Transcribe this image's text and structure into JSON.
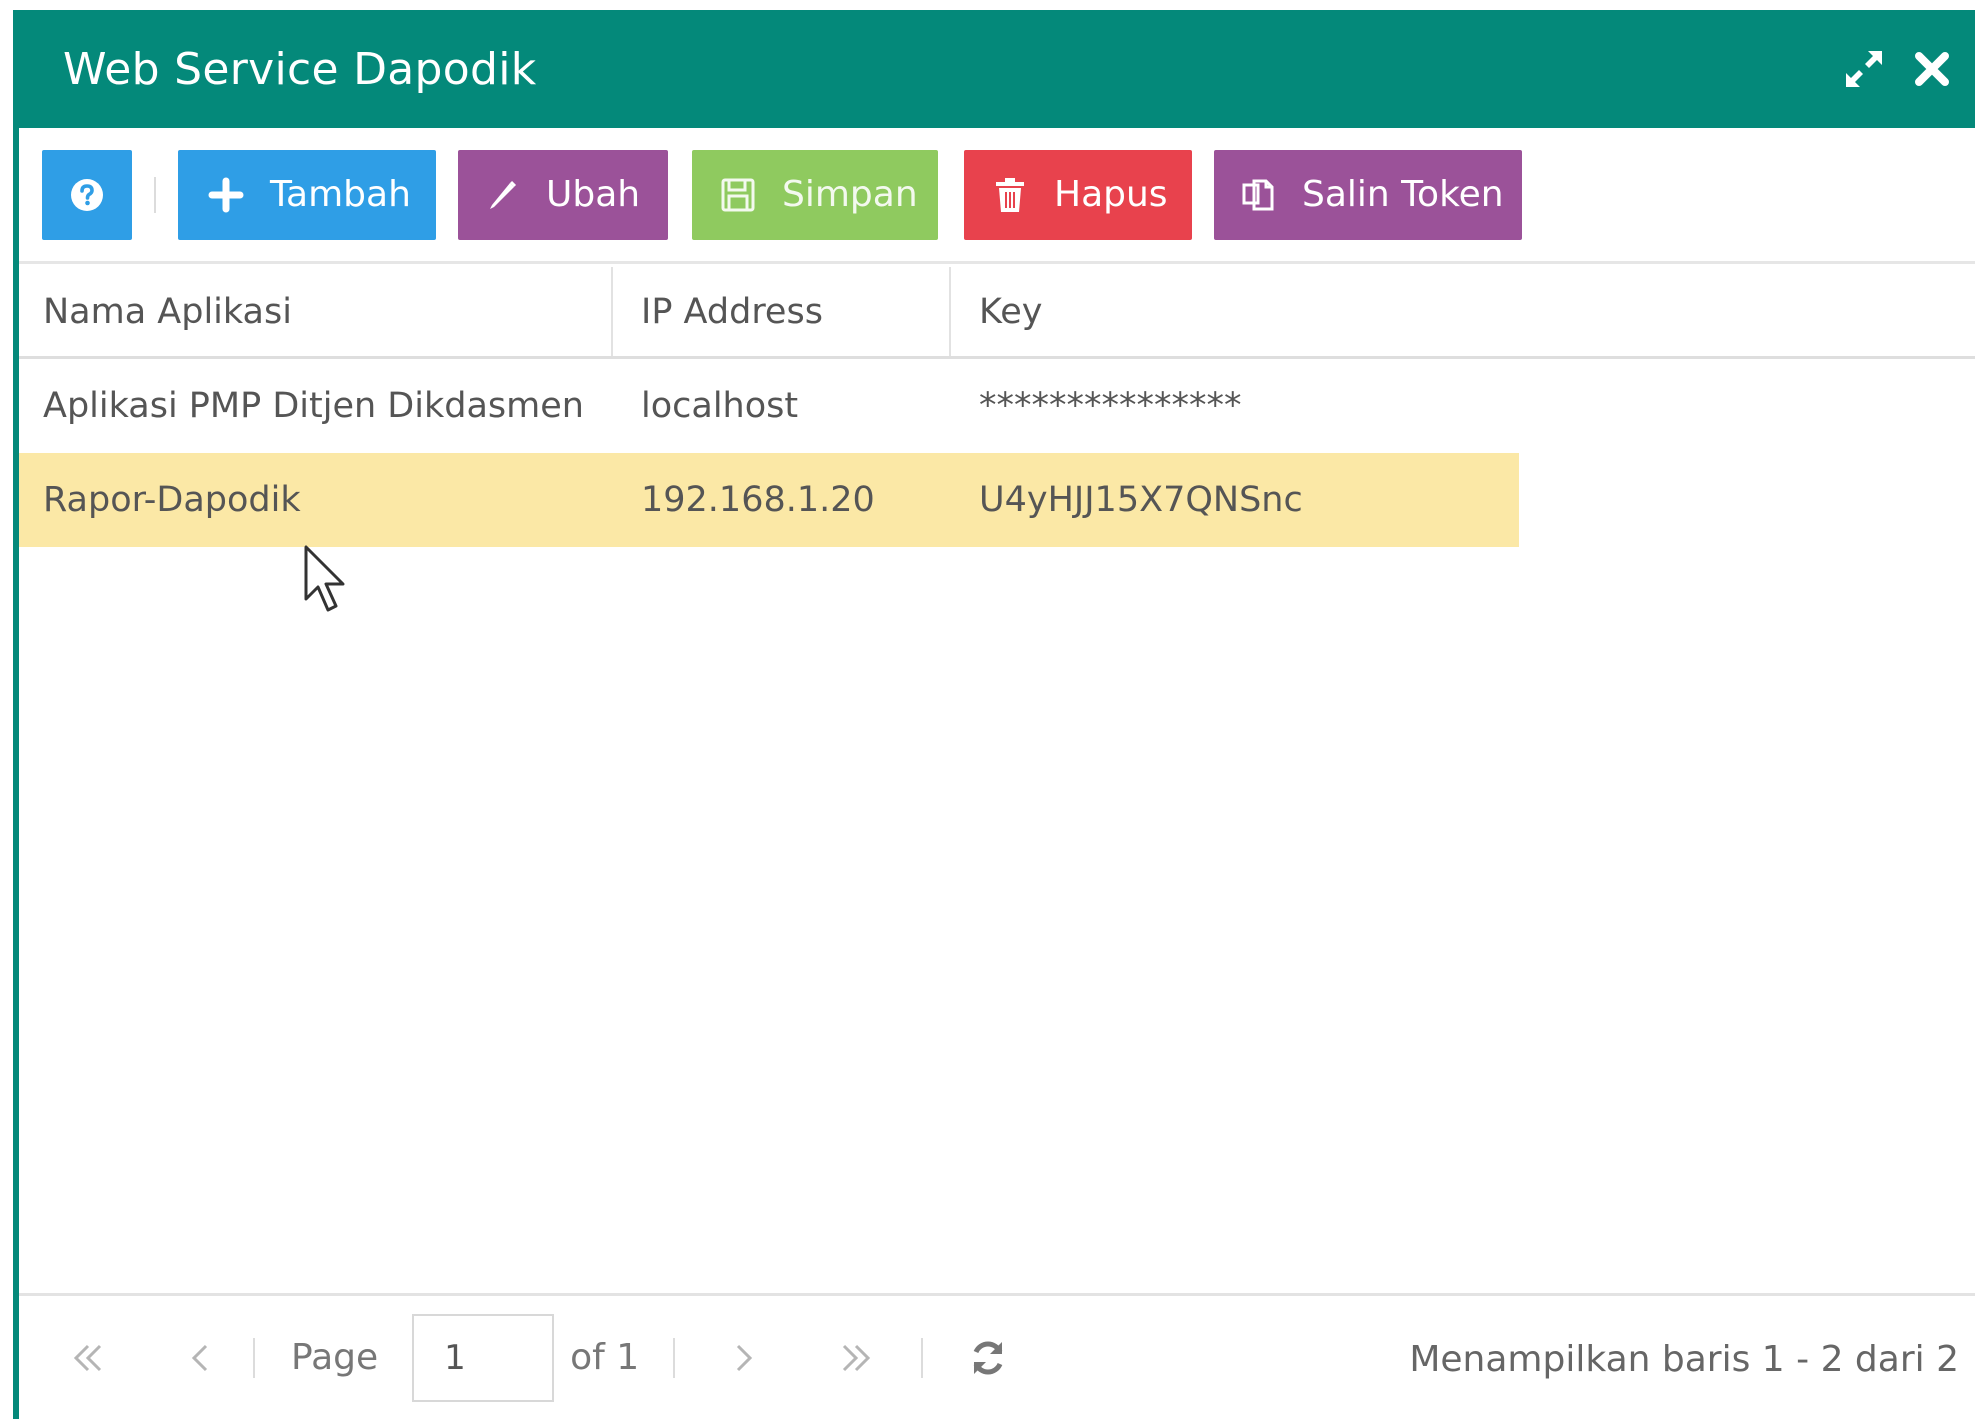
{
  "window": {
    "title": "Web Service Dapodik"
  },
  "toolbar": {
    "add_label": "Tambah",
    "edit_label": "Ubah",
    "save_label": "Simpan",
    "delete_label": "Hapus",
    "copy_token_label": "Salin Token"
  },
  "grid": {
    "columns": [
      "Nama Aplikasi",
      "IP Address",
      "Key"
    ],
    "rows": [
      {
        "nama": "Aplikasi PMP Ditjen Dikdasmen",
        "ip": "localhost",
        "key": "***************",
        "selected": false
      },
      {
        "nama": "Rapor-Dapodik",
        "ip": "192.168.1.20",
        "key": "U4yHJJ15X7QNSnc",
        "selected": true
      }
    ]
  },
  "pager": {
    "page_label": "Page",
    "page_value": "1",
    "of_label": "of 1",
    "status": "Menampilkan baris 1 - 2 dari 2"
  },
  "colors": {
    "header": "#04897a",
    "blue": "#2f9ee6",
    "purple": "#9b5299",
    "green": "#8fca5f",
    "red": "#e8424d",
    "selected_row": "#fbe8a6"
  },
  "icons": {
    "help": "question-circle-icon",
    "add": "plus-icon",
    "edit": "pencil-icon",
    "save": "floppy-disk-icon",
    "delete": "trash-icon",
    "copy": "copy-icon",
    "maximize": "expand-icon",
    "close": "close-icon",
    "first": "double-chevron-left-icon",
    "prev": "chevron-left-icon",
    "next": "chevron-right-icon",
    "last": "double-chevron-right-icon",
    "refresh": "refresh-icon"
  }
}
